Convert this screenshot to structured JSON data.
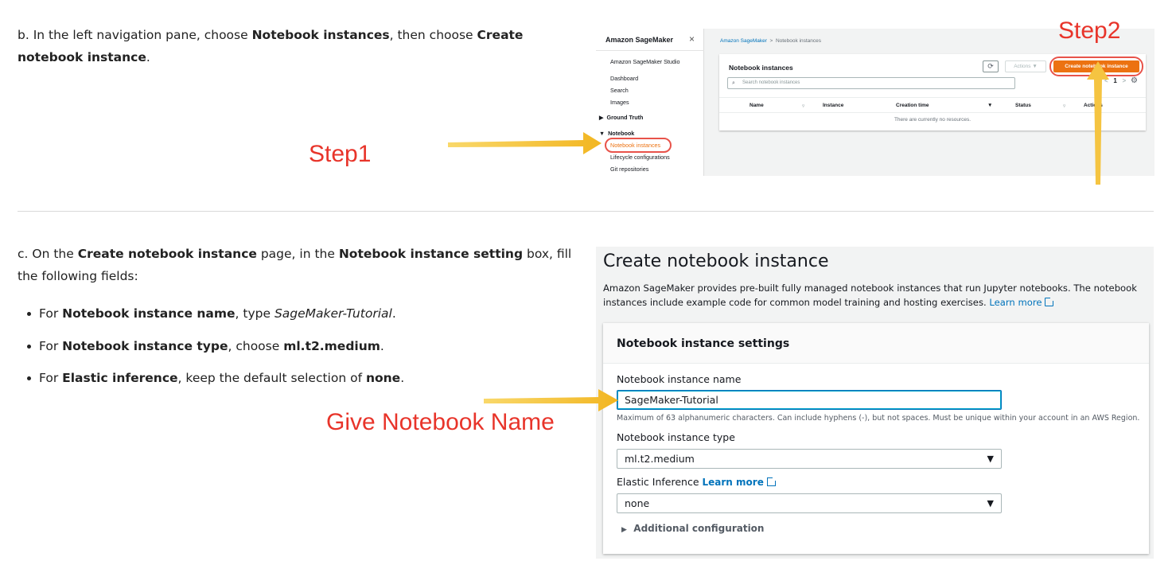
{
  "step_b": {
    "p1": "b. In the left navigation pane, choose ",
    "b1": "Notebook instances",
    "p2": ", then choose ",
    "b2": "Create notebook instance",
    "p3": "."
  },
  "step_c": {
    "p1": "c. On the ",
    "b1": "Create notebook instance",
    "p2": " page, in the ",
    "b2": "Notebook instance setting",
    "p3": " box, fill the following fields:",
    "bullets": [
      {
        "pre": "For ",
        "bold": "Notebook instance name",
        "mid": ", type ",
        "em": "SageMaker-Tutorial",
        "val": "",
        "post": "."
      },
      {
        "pre": "For ",
        "bold": "Notebook instance type",
        "mid": ", choose ",
        "em": "",
        "val": "ml.t2.medium",
        "post": "."
      },
      {
        "pre": "For ",
        "bold": "Elastic inference",
        "mid": ", keep the default selection of ",
        "em": "",
        "val": "none",
        "post": "."
      }
    ]
  },
  "annotations": {
    "step1": "Step1",
    "step2": "Step2",
    "give_name": "Give Notebook Name",
    "color": "#e8342a",
    "arrow_color": "#f5c441"
  },
  "shot1": {
    "brand": "Amazon SageMaker",
    "close": "×",
    "nav": {
      "studio": "Amazon SageMaker Studio",
      "dashboard": "Dashboard",
      "search": "Search",
      "images": "Images",
      "ground_truth": "Ground Truth",
      "notebook": "Notebook",
      "notebook_instances": "Notebook instances",
      "lifecycle": "Lifecycle configurations",
      "git": "Git repositories"
    },
    "breadcrumb_root": "Amazon SageMaker",
    "breadcrumb_sep": ">",
    "breadcrumb_current": "Notebook instances",
    "panel_title": "Notebook instances",
    "refresh_icon": "refresh-icon",
    "actions_label": "Actions ▼",
    "create_label": "Create notebook instance",
    "search_placeholder": "Search notebook instances",
    "pager_prev": "<",
    "pager_page": "1",
    "pager_next": ">",
    "columns": [
      "Name",
      "Instance",
      "Creation time",
      "Status",
      "Actions"
    ],
    "empty_text": "There are currently no resources.",
    "accent": "#ec7211"
  },
  "shot2": {
    "title": "Create notebook instance",
    "description": "Amazon SageMaker provides pre-built fully managed notebook instances that run Jupyter notebooks. The notebook instances include example code for common model training and hosting exercises.",
    "learn_more": "Learn more",
    "card_title": "Notebook instance settings",
    "name_label": "Notebook instance name",
    "name_value": "SageMaker-Tutorial",
    "name_hint": "Maximum of 63 alphanumeric characters. Can include hyphens (-), but not spaces. Must be unique within your account in an AWS Region.",
    "type_label": "Notebook instance type",
    "type_value": "ml.t2.medium",
    "ei_label": "Elastic Inference",
    "ei_learn_more": "Learn more",
    "ei_value": "none",
    "additional": "Additional configuration",
    "caret": "▼",
    "expand": "▶",
    "link_color": "#0073bb"
  }
}
